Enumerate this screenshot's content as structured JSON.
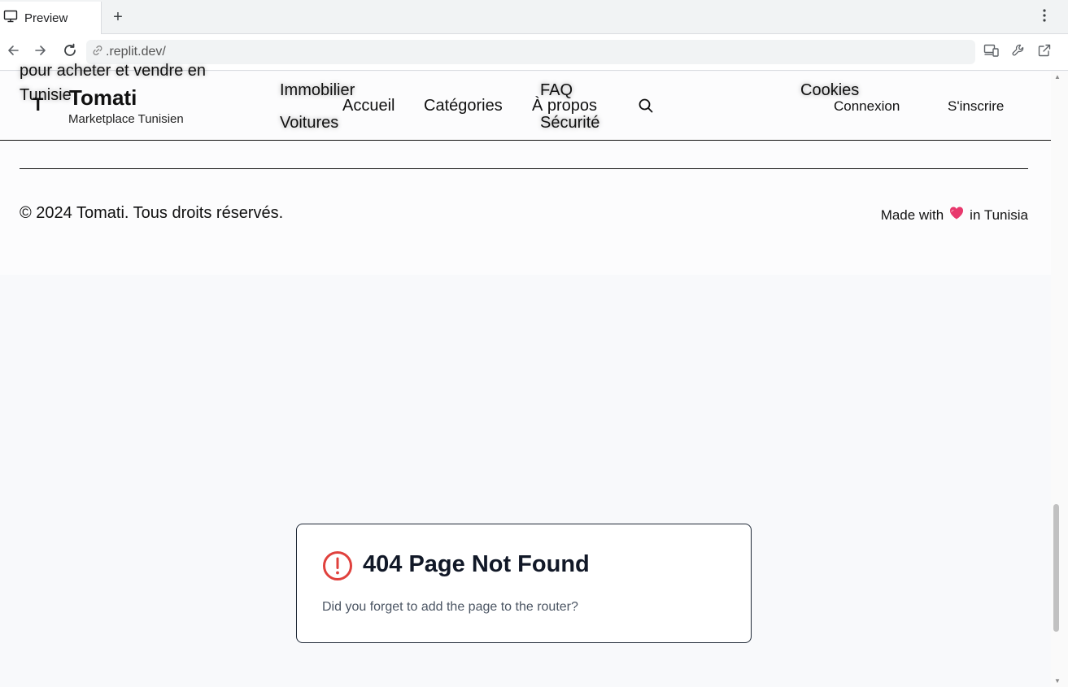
{
  "browser": {
    "tab_title": "Preview",
    "new_tab_symbol": "+",
    "url": ".replit.dev/"
  },
  "header": {
    "overflow_text_line1": "pour acheter et vendre en",
    "overflow_text_line2": "Tunisie",
    "brand_letter": "T",
    "brand_name": "Tomati",
    "brand_subtitle": "Marketplace Tunisien",
    "nav": {
      "home": "Accueil",
      "categories": "Catégories",
      "about": "À propos"
    },
    "overlay_links": {
      "real_estate": "Immobilier",
      "cars": "Voitures",
      "faq": "FAQ",
      "security": "Sécurité",
      "cookies": "Cookies"
    },
    "login": "Connexion",
    "signup": "S'inscrire"
  },
  "footer": {
    "copyright": "© 2024 Tomati. Tous droits réservés.",
    "made_with_prefix": "Made with",
    "made_with_suffix": "in Tunisia"
  },
  "not_found": {
    "title": "404 Page Not Found",
    "message": "Did you forget to add the page to the router?"
  },
  "colors": {
    "error_icon": "#e0413d",
    "heart": "#e8386d"
  },
  "icons": [
    "monitor-icon",
    "plus-icon",
    "more-vert-icon",
    "back-icon",
    "forward-icon",
    "reload-icon",
    "link-icon",
    "devices-icon",
    "wrench-icon",
    "open-external-icon",
    "search-icon",
    "heart-icon",
    "alert-circle-icon"
  ]
}
